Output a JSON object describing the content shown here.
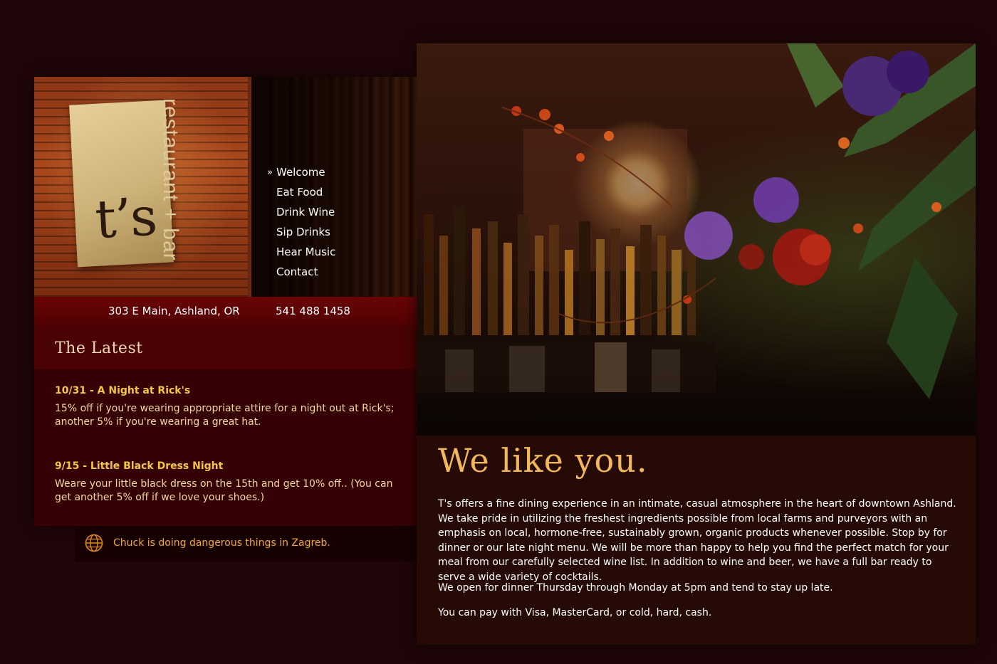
{
  "brand": {
    "logo_text": "t’s",
    "logo_subtext": "restaurant + bar"
  },
  "nav": {
    "active_marker": "»",
    "items": [
      {
        "label": "Welcome"
      },
      {
        "label": "Eat Food"
      },
      {
        "label": "Drink Wine"
      },
      {
        "label": "Sip Drinks"
      },
      {
        "label": "Hear Music"
      },
      {
        "label": "Contact"
      }
    ]
  },
  "contact": {
    "address": "303 E Main, Ashland, OR",
    "phone": "541 488 1458"
  },
  "latest": {
    "title": "The Latest",
    "items": [
      {
        "title": "10/31 - A Night at Rick's",
        "text": "15% off if you're wearing appropriate attire for a night out at Rick's; another 5% if you're wearing a great hat."
      },
      {
        "title": "9/15 - Little Black Dress Night",
        "text": "Weare your little black dress on the 15th and get 10% off.. (You can get another 5% off if we love your shoes.)"
      }
    ]
  },
  "status": {
    "icon": "globe-icon",
    "text": "Chuck is doing dangerous things in Zagreb."
  },
  "welcome": {
    "headline": "We like you.",
    "paragraphs": [
      "T's offers a fine dining experience in an intimate, casual atmosphere in the heart of downtown Ashland. We take pride in utilizing the freshest ingredients possible from local farms and purveyors with an emphasis on local, hormone-free, sustainably grown, organic products whenever possible. Stop by for dinner or our late night menu. We will be more than happy to help you find the perfect match for your meal from our carefully selected wine list. In addition to wine and beer, we have a full bar ready to serve a wide variety of cocktails.",
      "We open for dinner Thursday through Monday at 5pm and tend to stay up late.",
      "You can pay with Visa, MasterCard, or cold, hard, cash."
    ]
  },
  "colors": {
    "background": "#200608",
    "accent_gold": "#f5c842",
    "headline": "#f1b85c",
    "address_bar": "#6a0406",
    "status_text": "#f0a838"
  }
}
